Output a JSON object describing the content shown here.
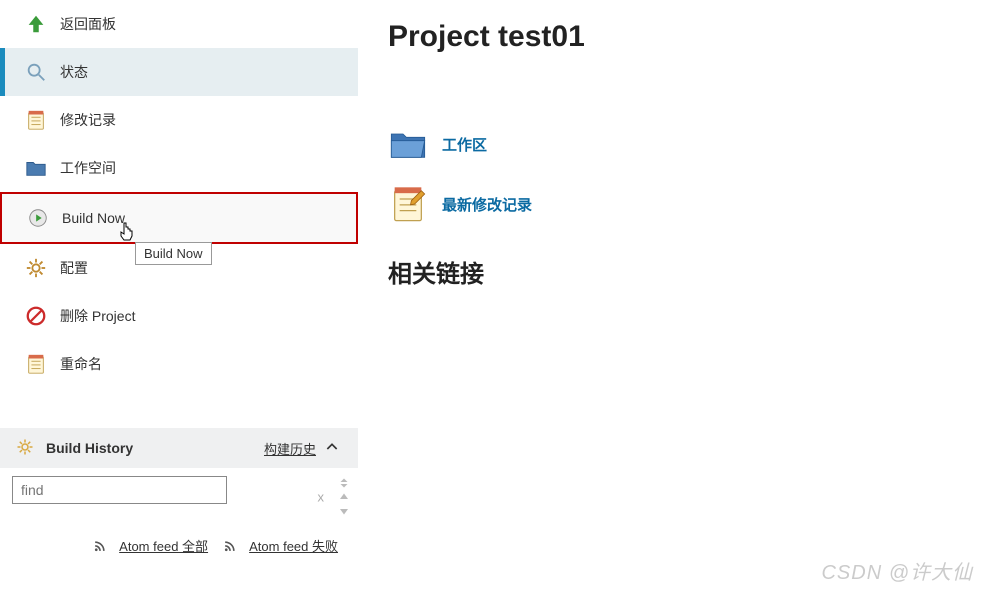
{
  "sidebar": {
    "items": [
      {
        "label": "返回面板",
        "icon": "up-arrow",
        "state": ""
      },
      {
        "label": "状态",
        "icon": "magnifier",
        "state": "active"
      },
      {
        "label": "修改记录",
        "icon": "notepad",
        "state": ""
      },
      {
        "label": "工作空间",
        "icon": "folder",
        "state": ""
      },
      {
        "label": "Build Now",
        "icon": "clock-play",
        "state": "highlighted"
      },
      {
        "label": "配置",
        "icon": "gear",
        "state": ""
      },
      {
        "label": "删除 Project",
        "icon": "deny",
        "state": ""
      },
      {
        "label": "重命名",
        "icon": "notepad",
        "state": ""
      }
    ]
  },
  "tooltip": {
    "text": "Build Now"
  },
  "history": {
    "title": "Build History",
    "link_label": "构建历史",
    "search_placeholder": "find",
    "feeds": [
      {
        "label": "Atom feed 全部"
      },
      {
        "label": "Atom feed 失败"
      }
    ]
  },
  "main": {
    "title": "Project test01",
    "links": [
      {
        "label": "工作区",
        "icon": "folder-big"
      },
      {
        "label": "最新修改记录",
        "icon": "notepad-big"
      }
    ],
    "related_title": "相关链接"
  },
  "watermark": "CSDN @许大仙"
}
